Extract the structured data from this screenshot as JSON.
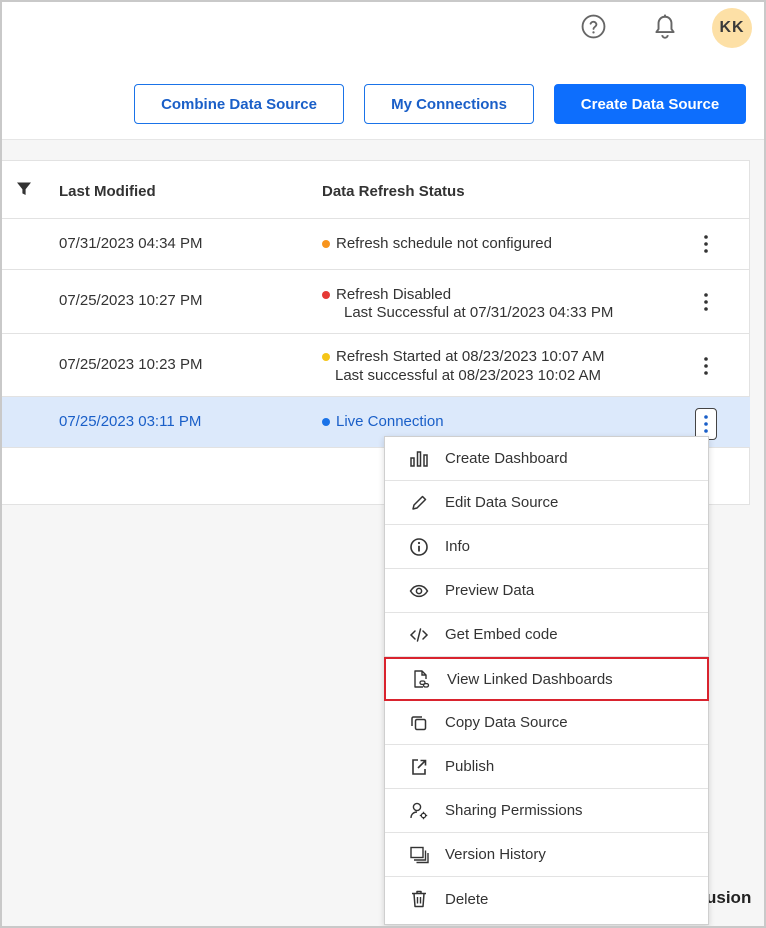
{
  "header": {
    "avatar_initials": "KK",
    "help_icon": "help-circle-icon",
    "notifications_icon": "bell-icon"
  },
  "actions": {
    "combine_label": "Combine Data Source",
    "connections_label": "My Connections",
    "create_label": "Create Data Source"
  },
  "table": {
    "columns": {
      "last_modified": "Last Modified",
      "refresh_status": "Data Refresh Status"
    },
    "rows": [
      {
        "date": "07/31/2023 04:34 PM",
        "status": "Refresh schedule not configured",
        "sub": "",
        "dot_color": "#f7941d"
      },
      {
        "date": "07/25/2023 10:27 PM",
        "status": "Refresh Disabled",
        "sub": "Last Successful at 07/31/2023 04:33 PM",
        "dot_color": "#e53935"
      },
      {
        "date": "07/25/2023 10:23 PM",
        "status": "Refresh Started at 08/23/2023 10:07 AM",
        "sub": "Last successful at 08/23/2023 10:02 AM",
        "dot_color": "#f5c518"
      },
      {
        "date": "07/25/2023 03:11 PM",
        "status": "Live Connection",
        "sub": "",
        "dot_color": "#1a73e8"
      }
    ]
  },
  "menu": {
    "items": [
      {
        "label": "Create Dashboard",
        "icon": "bar-chart-icon"
      },
      {
        "label": "Edit Data Source",
        "icon": "pencil-icon"
      },
      {
        "label": "Info",
        "icon": "info-icon"
      },
      {
        "label": "Preview Data",
        "icon": "eye-icon"
      },
      {
        "label": "Get Embed code",
        "icon": "code-icon"
      },
      {
        "label": "View Linked Dashboards",
        "icon": "linked-file-icon"
      },
      {
        "label": "Copy Data Source",
        "icon": "copy-icon"
      },
      {
        "label": "Publish",
        "icon": "publish-icon"
      },
      {
        "label": "Sharing Permissions",
        "icon": "user-settings-icon"
      },
      {
        "label": "Version History",
        "icon": "version-history-icon"
      },
      {
        "label": "Delete",
        "icon": "trash-icon"
      }
    ]
  },
  "footer": {
    "brand_fragment": "usion"
  },
  "colors": {
    "primary": "#0d6efd",
    "selected_row": "#dce9fb",
    "highlight_border": "#d9232e"
  }
}
